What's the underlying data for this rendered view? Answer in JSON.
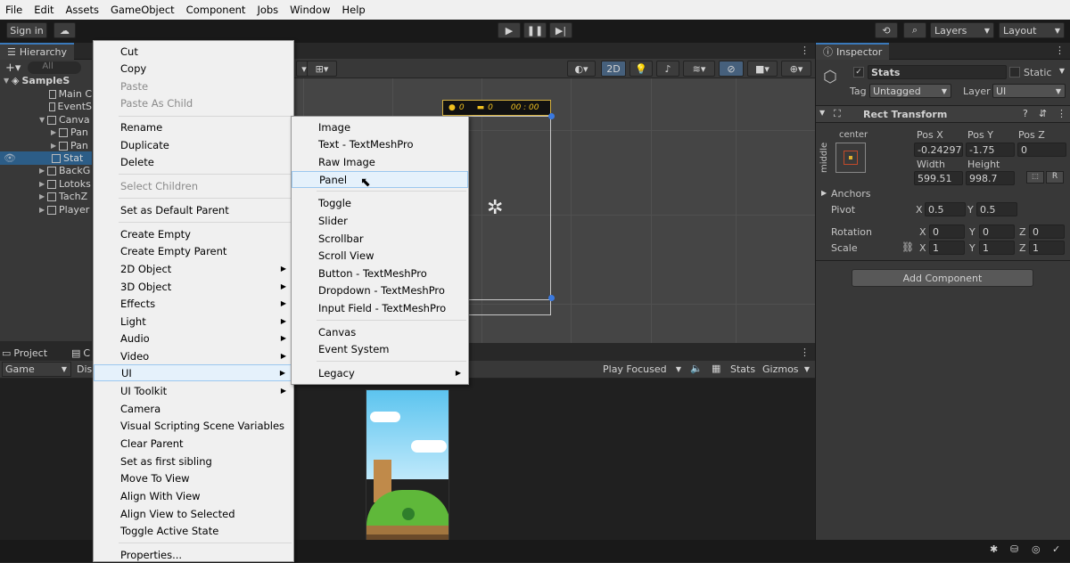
{
  "menubar": [
    "File",
    "Edit",
    "Assets",
    "GameObject",
    "Component",
    "Jobs",
    "Window",
    "Help"
  ],
  "toolbar": {
    "sign_in": "Sign in",
    "layers": "Layers",
    "layout": "Layout"
  },
  "hierarchy": {
    "tab": "Hierarchy",
    "search_placeholder": "All",
    "rows": [
      "SampleS",
      "Main C",
      "EventS",
      "Canva",
      "Pan",
      "Pan",
      "Stat",
      "BackG",
      "Lotoks",
      "TachZ",
      "Player"
    ]
  },
  "scene": {
    "mode_2d": "2D",
    "banner_left": "0",
    "banner_right": "00 : 00",
    "banner_mid": "0"
  },
  "bottom": {
    "tab_project": "Project",
    "tab_console": "C",
    "game_label": "Game",
    "display_label": "Dis",
    "play_focused": "Play Focused",
    "stats": "Stats",
    "gizmos": "Gizmos"
  },
  "inspector": {
    "tab": "Inspector",
    "object_name": "Stats",
    "static_label": "Static",
    "tag_label": "Tag",
    "tag_value": "Untagged",
    "layer_label": "Layer",
    "layer_value": "UI",
    "component_title": "Rect Transform",
    "anchor_h": "center",
    "anchor_v": "middle",
    "pos_x_label": "Pos X",
    "pos_y_label": "Pos Y",
    "pos_z_label": "Pos Z",
    "pos_x": "-0.24297",
    "pos_y": "-1.75",
    "pos_z": "0",
    "width_label": "Width",
    "height_label": "Height",
    "width": "599.51",
    "height": "998.7",
    "r_button": "R",
    "anchors_label": "Anchors",
    "pivot_label": "Pivot",
    "pivot_x": "0.5",
    "pivot_y": "0.5",
    "rotation_label": "Rotation",
    "rot_x": "0",
    "rot_y": "0",
    "rot_z": "0",
    "scale_label": "Scale",
    "scale_x": "1",
    "scale_y": "1",
    "scale_z": "1",
    "x_label": "X",
    "y_label": "Y",
    "z_label": "Z",
    "add_component": "Add Component"
  },
  "context_menu": {
    "items": [
      {
        "label": "Cut"
      },
      {
        "label": "Copy"
      },
      {
        "label": "Paste",
        "disabled": true
      },
      {
        "label": "Paste As Child",
        "disabled": true
      },
      {
        "label": "Rename"
      },
      {
        "label": "Duplicate"
      },
      {
        "label": "Delete"
      },
      {
        "label": "Select Children",
        "disabled": true
      },
      {
        "label": "Set as Default Parent"
      },
      {
        "label": "Create Empty"
      },
      {
        "label": "Create Empty Parent"
      },
      {
        "label": "2D Object"
      },
      {
        "label": "3D Object"
      },
      {
        "label": "Effects"
      },
      {
        "label": "Light"
      },
      {
        "label": "Audio"
      },
      {
        "label": "Video"
      },
      {
        "label": "UI"
      },
      {
        "label": "UI Toolkit"
      },
      {
        "label": "Camera"
      },
      {
        "label": "Visual Scripting Scene Variables"
      },
      {
        "label": "Clear Parent"
      },
      {
        "label": "Set as first sibling"
      },
      {
        "label": "Move To View"
      },
      {
        "label": "Align With View"
      },
      {
        "label": "Align View to Selected"
      },
      {
        "label": "Toggle Active State"
      },
      {
        "label": "Properties..."
      }
    ]
  },
  "ui_submenu": {
    "items": [
      {
        "label": "Image"
      },
      {
        "label": "Text - TextMeshPro"
      },
      {
        "label": "Raw Image"
      },
      {
        "label": "Panel"
      },
      {
        "label": "Toggle"
      },
      {
        "label": "Slider"
      },
      {
        "label": "Scrollbar"
      },
      {
        "label": "Scroll View"
      },
      {
        "label": "Button - TextMeshPro"
      },
      {
        "label": "Dropdown - TextMeshPro"
      },
      {
        "label": "Input Field - TextMeshPro"
      },
      {
        "label": "Canvas"
      },
      {
        "label": "Event System"
      },
      {
        "label": "Legacy"
      }
    ]
  },
  "colors": {
    "accent": "#3a79bb",
    "selection": "#2c5d87",
    "menu_bg": "#f0f0f0",
    "menu_highlight": "#e5f1fb"
  }
}
